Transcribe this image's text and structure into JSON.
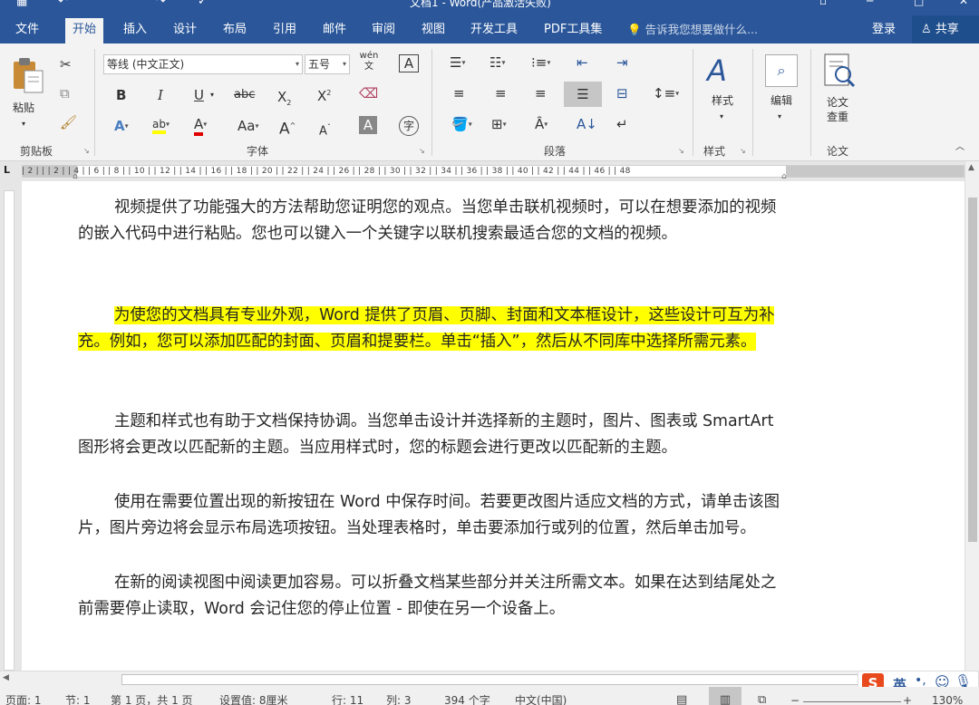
{
  "window": {
    "title": "文档1 - Word(产品激活失败)"
  },
  "tabs": [
    "文件",
    "开始",
    "插入",
    "设计",
    "布局",
    "引用",
    "邮件",
    "审阅",
    "视图",
    "开发工具",
    "PDF工具集"
  ],
  "active_tab": "开始",
  "tell_me": "告诉我您想要做什么...",
  "account": {
    "login": "登录",
    "share": "共享"
  },
  "ribbon": {
    "clipboard": {
      "paste": "粘贴",
      "group": "剪贴板"
    },
    "font": {
      "name": "等线 (中文正文)",
      "size": "五号",
      "wen": "wén",
      "group": "字体",
      "bold": "B",
      "italic": "I",
      "underline": "U",
      "strike": "abc",
      "sub": "X",
      "sup": "X",
      "change_case": "Aa",
      "grow": "A",
      "shrink": "A",
      "clear": "A"
    },
    "paragraph": {
      "group": "段落"
    },
    "styles": {
      "label": "样式",
      "group": "样式"
    },
    "editing": {
      "label": "编辑"
    },
    "paper": {
      "label1": "论文",
      "label2": "查重",
      "group": "论文"
    }
  },
  "ruler_ticks": "| 2 |     |     | 2 |   | 4 |   | 6 |   | 8 |   | 10 |  | 12 |  | 14 |  | 16 |  | 18 |  | 20 |  | 22 |  | 24 |  | 26 |  | 28 |  | 30 |  | 32 |  | 34 |  | 36 |  | 38 |  | 40 |  | 42 |  | 44 |  | 46 |  | 48",
  "document": {
    "p1": "视频提供了功能强大的方法帮助您证明您的观点。当您单击联机视频时，可以在想要添加的视频的嵌入代码中进行粘贴。您也可以键入一个关键字以联机搜索最适合您的文档的视频。",
    "p2": "为使您的文档具有专业外观，Word 提供了页眉、页脚、封面和文本框设计，这些设计可互为补充。例如，您可以添加匹配的封面、页眉和提要栏。单击“插入”，然后从不同库中选择所需元素。",
    "p3": "主题和样式也有助于文档保持协调。当您单击设计并选择新的主题时，图片、图表或 SmartArt 图形将会更改以匹配新的主题。当应用样式时，您的标题会进行更改以匹配新的主题。",
    "p4": "使用在需要位置出现的新按钮在 Word 中保存时间。若要更改图片适应文档的方式，请单击该图片，图片旁边将会显示布局选项按钮。当处理表格时，单击要添加行或列的位置，然后单击加号。",
    "p5": "在新的阅读视图中阅读更加容易。可以折叠文档某些部分并关注所需文本。如果在达到结尾处之前需要停止读取，Word 会记住您的停止位置 - 即使在另一个设备上。"
  },
  "status": {
    "page": "页面: 1",
    "section": "节: 1",
    "pages": "第 1 页，共 1 页",
    "setting": "设置值: 8厘米",
    "line": "行: 11",
    "col": "列: 3",
    "words": "394 个字",
    "lang": "中文(中国)",
    "zoom": "130%"
  },
  "ime": {
    "logo": "S",
    "mode": "英"
  },
  "colors": {
    "accent": "#2b579a",
    "highlight": "#ffff00",
    "font_color": "#e00000"
  }
}
